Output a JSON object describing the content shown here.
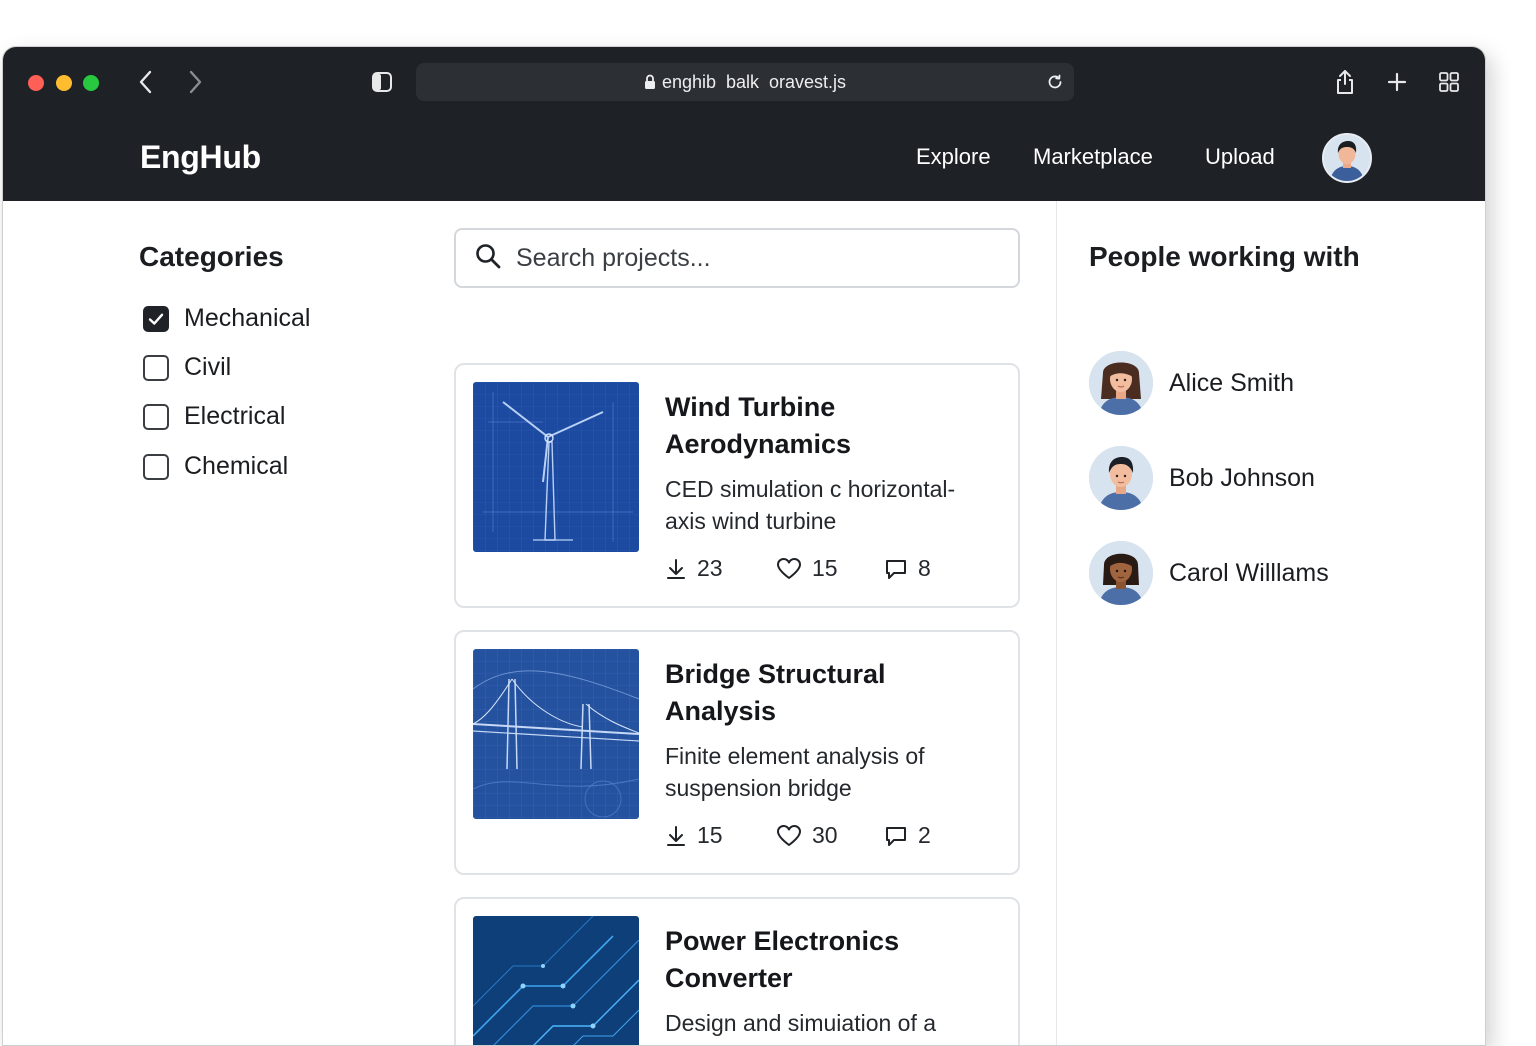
{
  "browser": {
    "url": "enghib  balk  oravest.js",
    "icons": [
      "back-icon",
      "forward-icon",
      "sidebar-icon",
      "lock-icon",
      "reload-icon",
      "share-icon",
      "new-tab-icon",
      "tab-overview-icon"
    ]
  },
  "header": {
    "brand": "EngHub",
    "nav": {
      "explore": "Explore",
      "marketplace": "Marketplace",
      "upload": "Upload"
    }
  },
  "sidebar": {
    "title": "Categories",
    "categories": [
      {
        "label": "Mechanical",
        "checked": true
      },
      {
        "label": "Civil",
        "checked": false
      },
      {
        "label": "Electrical",
        "checked": false
      },
      {
        "label": "Chemical",
        "checked": false
      }
    ]
  },
  "search": {
    "placeholder": "Search projects..."
  },
  "projects": [
    {
      "title": "Wind Turbine Aerodynamics",
      "description": "CED simulation c horizontal-axis wind turbine",
      "downloads": "23",
      "likes": "15",
      "comments": "8"
    },
    {
      "title": "Bridge Structural Analysis",
      "description": "Finite element analysis of suspension bridge",
      "downloads": "15",
      "likes": "30",
      "comments": "2"
    },
    {
      "title": "Power Electronics Converter",
      "description": "Design and simuiation of a DC~DC converter",
      "downloads": "",
      "likes": "",
      "comments": ""
    }
  ],
  "people": {
    "title": "People working with",
    "list": [
      {
        "name": "Alice Smith"
      },
      {
        "name": "Bob Johnson"
      },
      {
        "name": "Carol Willlams"
      }
    ]
  },
  "colors": {
    "header_bg": "#1e2125",
    "blueprint": "#1f4fa3",
    "accent_dark": "#1f2226"
  }
}
